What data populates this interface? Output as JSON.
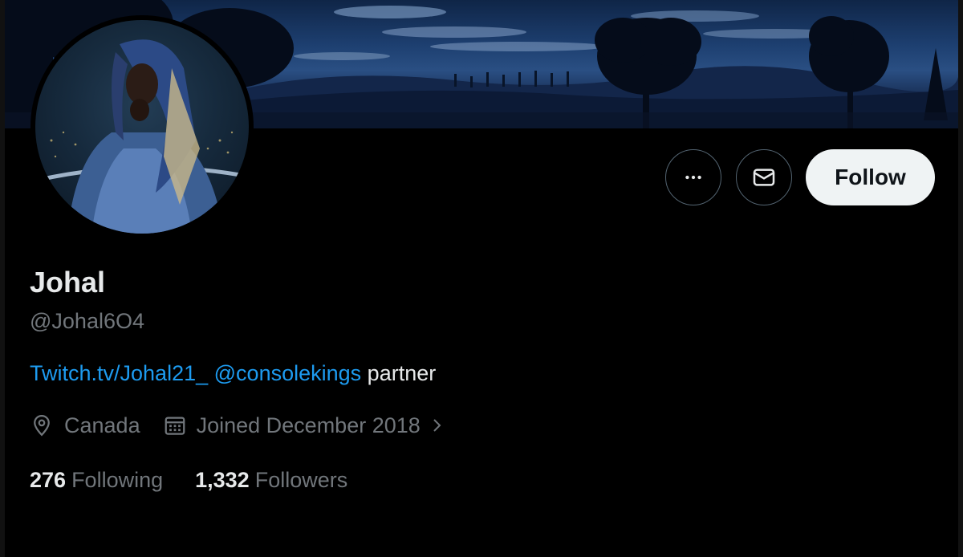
{
  "profile": {
    "display_name": "Johal",
    "handle": "@Johal6O4",
    "bio": {
      "link1": "Twitch.tv/Johal21_",
      "mention": "@consolekings",
      "text": "partner"
    },
    "location": "Canada",
    "joined": "Joined December 2018"
  },
  "actions": {
    "more_icon": "more-horizontal-icon",
    "message_icon": "envelope-icon",
    "follow_label": "Follow"
  },
  "stats": {
    "following_count": "276",
    "following_label": "Following",
    "followers_count": "1,332",
    "followers_label": "Followers"
  },
  "colors": {
    "background": "#000000",
    "text_primary": "#e7e9ea",
    "text_secondary": "#71767b",
    "link": "#1d9bf0",
    "follow_bg": "#eff3f4",
    "border": "#536471"
  }
}
